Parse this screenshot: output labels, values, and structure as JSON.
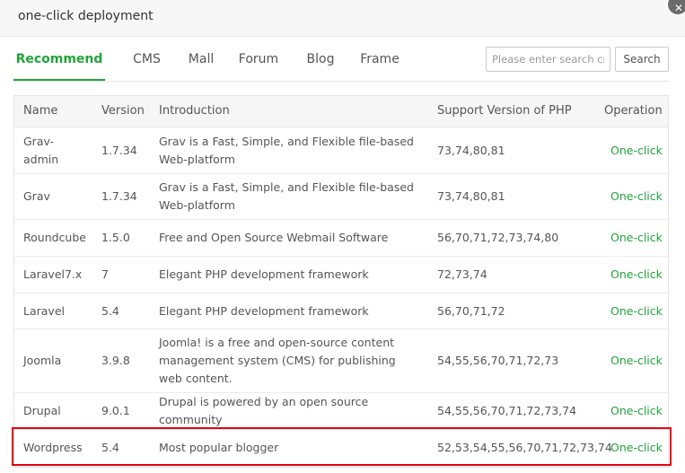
{
  "dialog": {
    "title": "one-click deployment",
    "close_icon": "close-icon"
  },
  "tabs": [
    {
      "label": "Recommend",
      "active": true
    },
    {
      "label": "CMS",
      "active": false
    },
    {
      "label": "Mall",
      "active": false
    },
    {
      "label": "Forum",
      "active": false
    },
    {
      "label": "Blog",
      "active": false
    },
    {
      "label": "Frame",
      "active": false
    }
  ],
  "search": {
    "placeholder": "Please enter search criteria",
    "button_label": "Search"
  },
  "table": {
    "columns": [
      "Name",
      "Version",
      "Introduction",
      "Support Version of PHP",
      "Operation"
    ],
    "rows": [
      {
        "name": "Grav-admin",
        "version": "1.7.34",
        "intro": "Grav is a Fast, Simple, and Flexible file-based Web-platform",
        "php": "73,74,80,81",
        "op": "One-click"
      },
      {
        "name": "Grav",
        "version": "1.7.34",
        "intro": "Grav is a Fast, Simple, and Flexible file-based Web-platform",
        "php": "73,74,80,81",
        "op": "One-click"
      },
      {
        "name": "Roundcube",
        "version": "1.5.0",
        "intro": "Free and Open Source Webmail Software",
        "php": "56,70,71,72,73,74,80",
        "op": "One-click"
      },
      {
        "name": "Laravel7.x",
        "version": "7",
        "intro": "Elegant PHP development framework",
        "php": "72,73,74",
        "op": "One-click"
      },
      {
        "name": "Laravel",
        "version": "5.4",
        "intro": "Elegant PHP development framework",
        "php": "56,70,71,72",
        "op": "One-click"
      },
      {
        "name": "Joomla",
        "version": "3.9.8",
        "intro": "Joomla! is a free and open-source content management system (CMS) for publishing web content.",
        "php": "54,55,56,70,71,72,73",
        "op": "One-click"
      },
      {
        "name": "Drupal",
        "version": "9.0.1",
        "intro": "Drupal is powered by an open source community",
        "php": "54,55,56,70,71,72,73,74",
        "op": "One-click"
      },
      {
        "name": "Wordpress",
        "version": "5.4",
        "intro": "Most popular blogger",
        "php": "52,53,54,55,56,70,71,72,73,74",
        "op": "One-click"
      }
    ]
  },
  "colors": {
    "accent": "#20a53a",
    "highlight": "#e60012"
  }
}
